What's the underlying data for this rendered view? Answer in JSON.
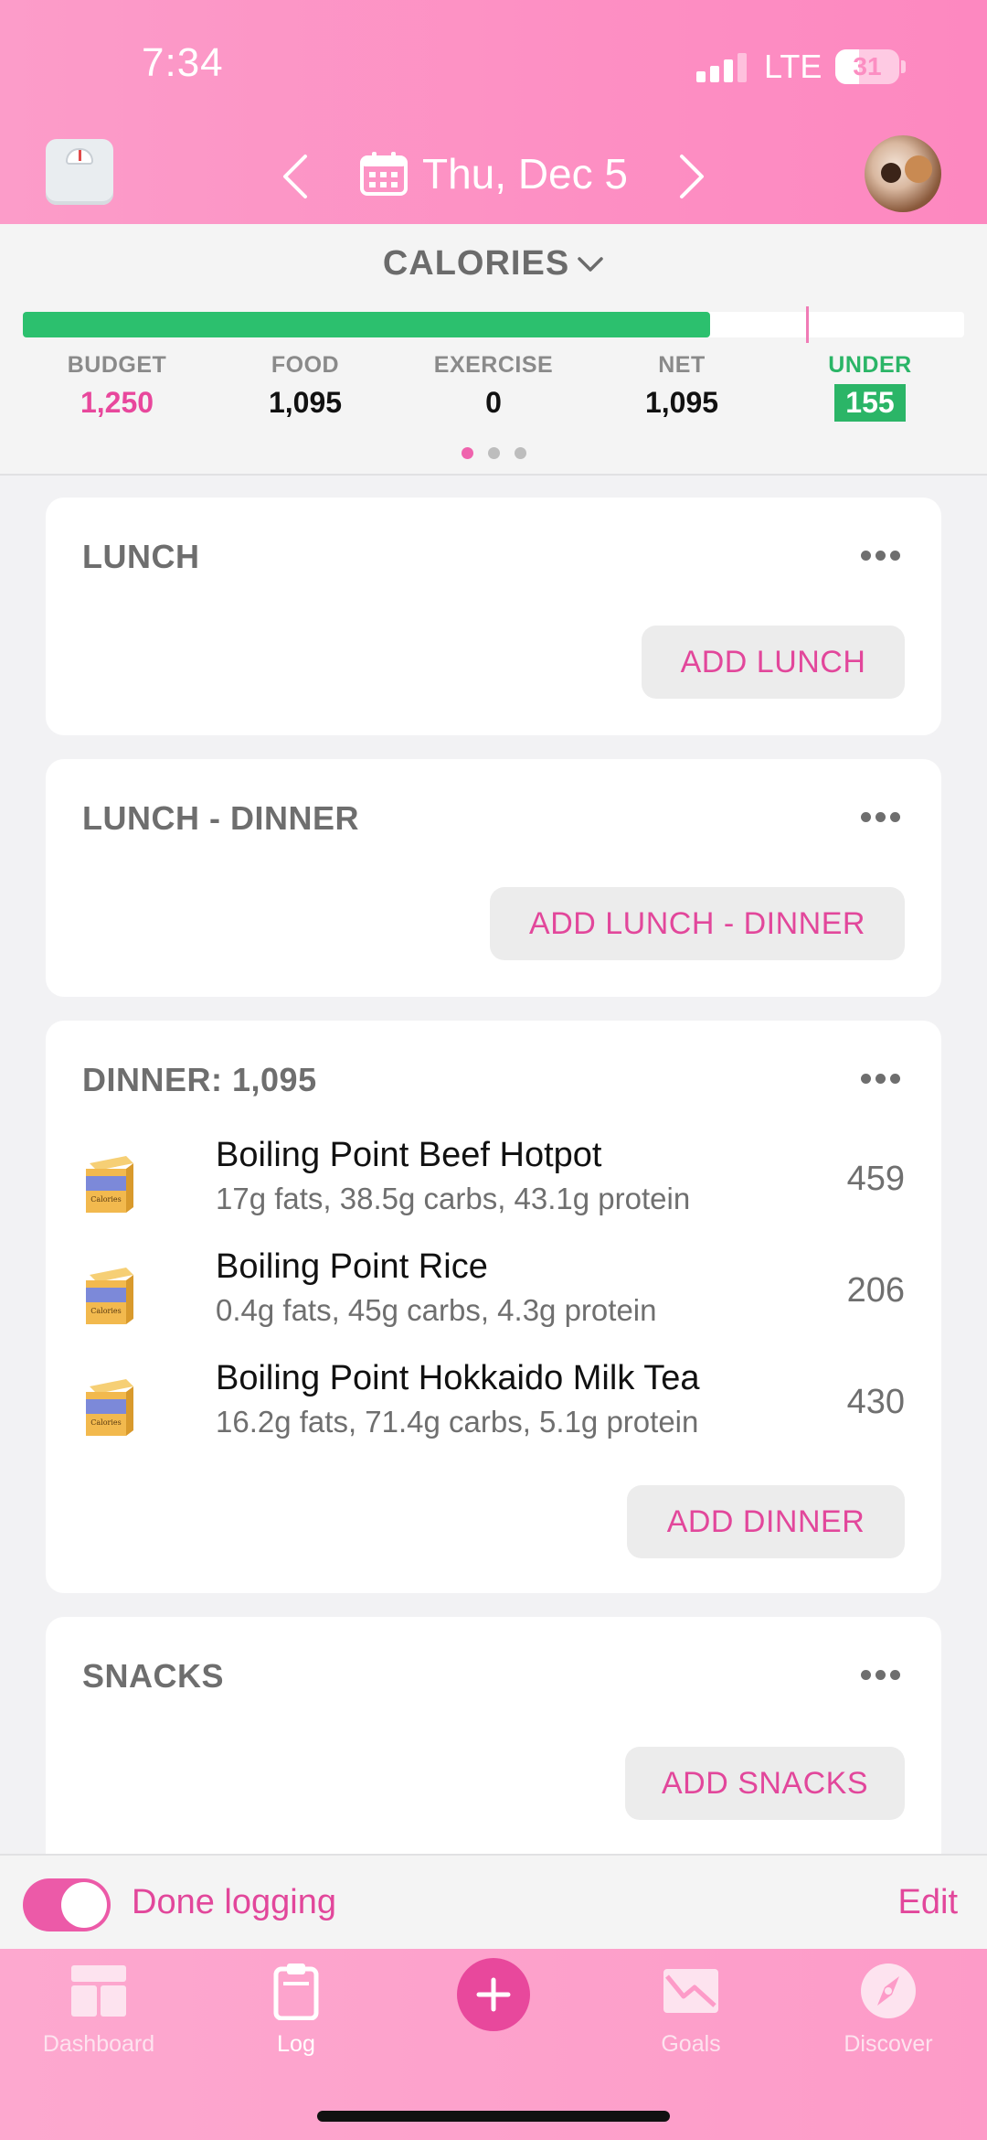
{
  "status_bar": {
    "time": "7:34",
    "network": "LTE",
    "battery": "31"
  },
  "header": {
    "date": "Thu, Dec 5"
  },
  "calories": {
    "title": "CALORIES",
    "progress_fraction": 0.73,
    "marker_fraction": 0.832,
    "budget": {
      "label": "BUDGET",
      "value": "1,250"
    },
    "food": {
      "label": "FOOD",
      "value": "1,095"
    },
    "exercise": {
      "label": "EXERCISE",
      "value": "0"
    },
    "net": {
      "label": "NET",
      "value": "1,095"
    },
    "under": {
      "label": "UNDER",
      "value": "155"
    },
    "page_dots": 3,
    "active_dot": 0
  },
  "meals": {
    "lunch": {
      "title": "LUNCH",
      "add_label": "ADD LUNCH"
    },
    "lunch_dinner": {
      "title": "LUNCH - DINNER",
      "add_label": "ADD LUNCH - DINNER"
    },
    "dinner": {
      "title": "DINNER: 1,095",
      "add_label": "ADD DINNER",
      "items": [
        {
          "name": "Boiling Point Beef Hotpot",
          "macros": "17g fats, 38.5g carbs, 43.1g protein",
          "calories": "459"
        },
        {
          "name": "Boiling Point Rice",
          "macros": "0.4g fats, 45g carbs, 4.3g protein",
          "calories": "206"
        },
        {
          "name": "Boiling Point Hokkaido Milk Tea",
          "macros": "16.2g fats, 71.4g carbs, 5.1g protein",
          "calories": "430"
        }
      ]
    },
    "snacks": {
      "title": "SNACKS",
      "add_label": "ADD SNACKS"
    }
  },
  "done_logging": {
    "label": "Done logging",
    "enabled": true,
    "edit_label": "Edit"
  },
  "tabbar": {
    "tabs": [
      {
        "label": "Dashboard",
        "icon": "dashboard-icon"
      },
      {
        "label": "Log",
        "icon": "clipboard-icon"
      },
      {
        "label": "Goals",
        "icon": "chart-envelope-icon"
      },
      {
        "label": "Discover",
        "icon": "compass-icon"
      }
    ],
    "active_tab": "Log"
  },
  "colors": {
    "accent_pink": "#e2479b",
    "header_pink": "#fd8fc3",
    "progress_green": "#2cc06e"
  }
}
